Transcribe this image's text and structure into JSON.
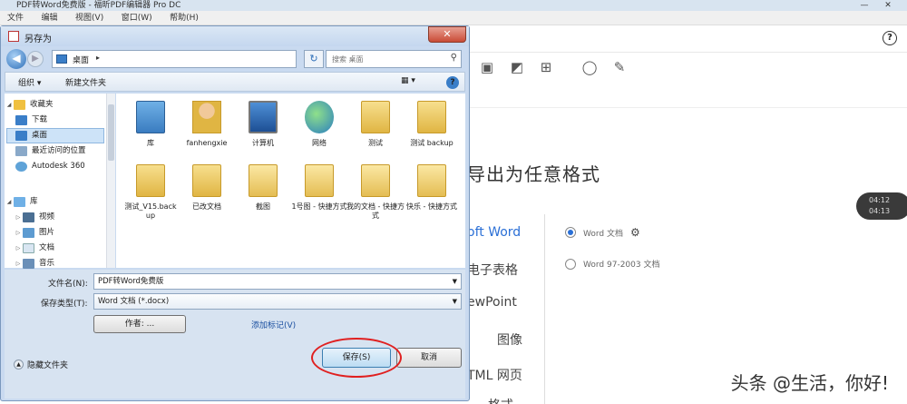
{
  "app": {
    "title": "PDF转Word免费版 - 福昕PDF编辑器 Pro DC",
    "menu": [
      "文件",
      "编辑",
      "视图(V)",
      "窗口(W)",
      "帮助(H)"
    ],
    "help_symbol": "?"
  },
  "export_panel": {
    "heading": "导出为任意格式",
    "formats": [
      "oft Word",
      "电子表格",
      "ewPoint",
      "图像",
      "TML 网页",
      "格式"
    ],
    "options": [
      {
        "label": "Word 文档",
        "selected": true
      },
      {
        "label": "Word 97-2003 文档",
        "selected": false
      }
    ],
    "side_pill": [
      "04:12",
      "04:13"
    ]
  },
  "dialog": {
    "title": "另存为",
    "close_symbol": "✕",
    "address": {
      "location": "桌面",
      "separator": "▸"
    },
    "search_placeholder": "搜索 桌面",
    "toolbar": {
      "organize": "组织 ▾",
      "new_folder": "新建文件夹"
    },
    "nav": {
      "favorites": "收藏夹",
      "items": [
        {
          "label": "下载",
          "color": "#3a7ec8"
        },
        {
          "label": "桌面",
          "color": "#3a7ec8",
          "selected": true
        },
        {
          "label": "最近访问的位置",
          "color": "#8aa9c9"
        },
        {
          "label": "Autodesk 360",
          "color": "#5fa3d8"
        }
      ],
      "libraries": "库",
      "lib_items": [
        "视频",
        "图片",
        "文档",
        "音乐"
      ]
    },
    "files": [
      {
        "label": "库",
        "icon": "lib"
      },
      {
        "label": "fanhengxie",
        "icon": "user"
      },
      {
        "label": "计算机",
        "icon": "pc"
      },
      {
        "label": "网络",
        "icon": "globe"
      },
      {
        "label": "测试",
        "icon": "folder"
      },
      {
        "label": "测试 backup",
        "icon": "folder"
      },
      {
        "label": "测试_V15.back up",
        "icon": "folder"
      },
      {
        "label": "已改文档",
        "icon": "folder"
      },
      {
        "label": "截图",
        "icon": "folder-doc"
      },
      {
        "label": "1号图 - 快捷方式",
        "icon": "folder-doc"
      },
      {
        "label": "我的文档 - 快捷方式",
        "icon": "folder-doc"
      },
      {
        "label": "快乐 - 快捷方式",
        "icon": "folder-doc"
      }
    ],
    "form": {
      "filename_label": "文件名(N):",
      "filename": "PDF转Word免费版",
      "type_label": "保存类型(T):",
      "type_value": "Word 文档 (*.docx)",
      "authors_button": "作者: ...",
      "tags_link": "添加标记(V)"
    },
    "hide_folders": "隐藏文件夹",
    "save": "保存(S)",
    "cancel": "取消"
  },
  "watermark": "头条 @生活，你好!"
}
